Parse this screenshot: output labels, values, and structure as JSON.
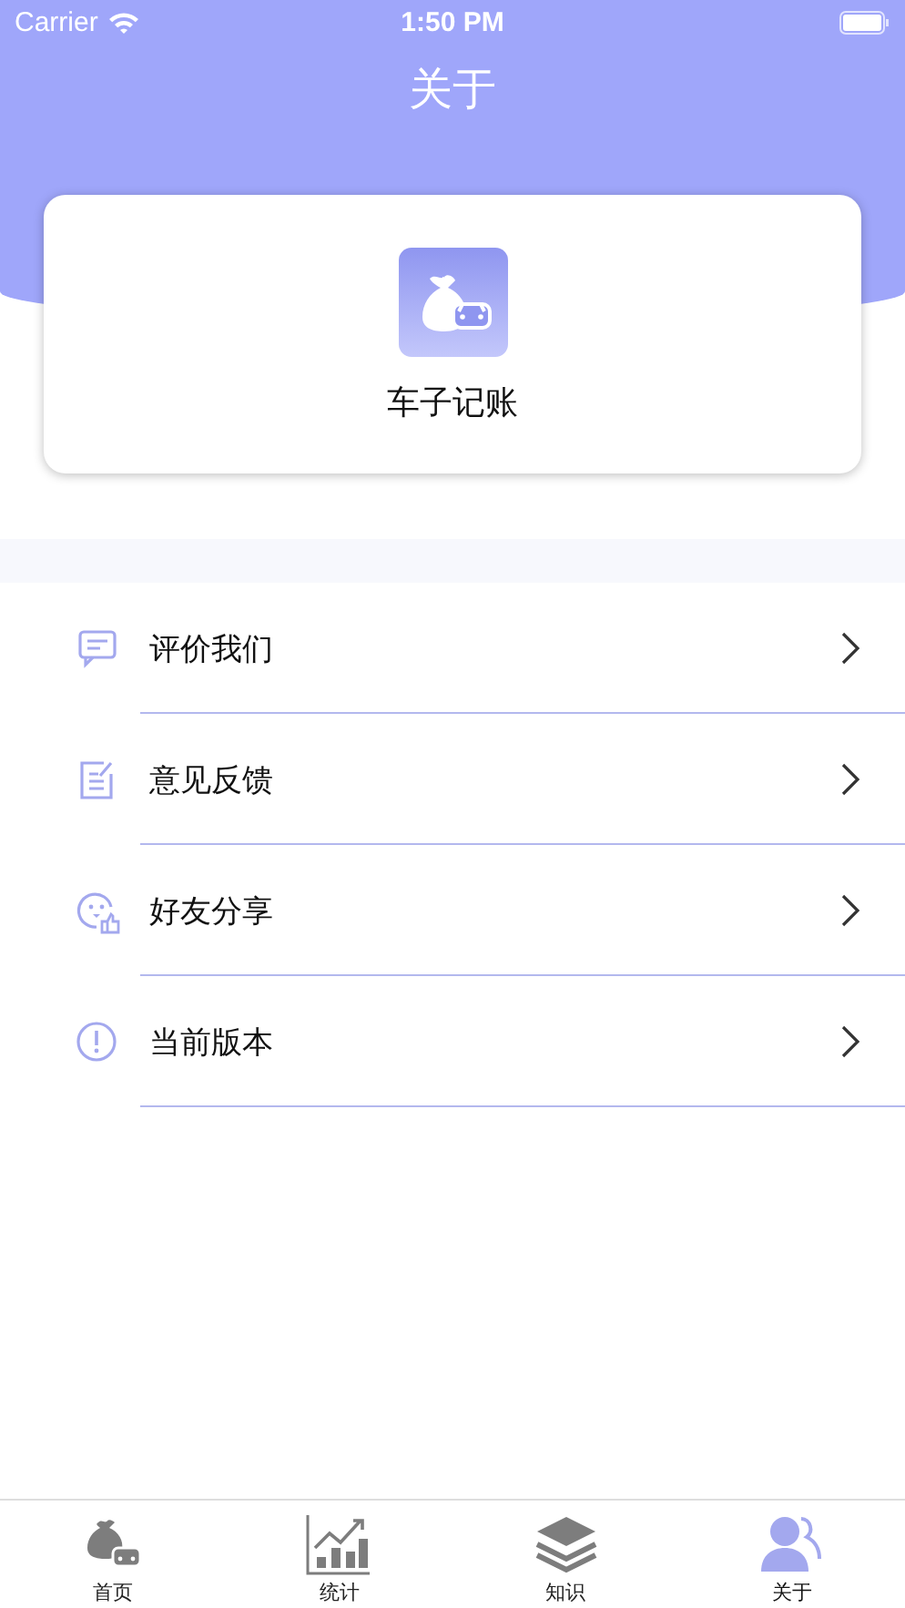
{
  "status_bar": {
    "carrier": "Carrier",
    "time": "1:50 PM"
  },
  "title": "关于",
  "app": {
    "name": "车子记账"
  },
  "menu": [
    {
      "label": "评价我们",
      "kind": "comment"
    },
    {
      "label": "意见反馈",
      "kind": "feedback"
    },
    {
      "label": "好友分享",
      "kind": "share"
    },
    {
      "label": "当前版本",
      "kind": "info"
    }
  ],
  "tabs": [
    {
      "label": "首页",
      "kind": "home",
      "selected": false
    },
    {
      "label": "统计",
      "kind": "stats",
      "selected": false
    },
    {
      "label": "知识",
      "kind": "layers",
      "selected": false
    },
    {
      "label": "关于",
      "kind": "about",
      "selected": true
    }
  ]
}
